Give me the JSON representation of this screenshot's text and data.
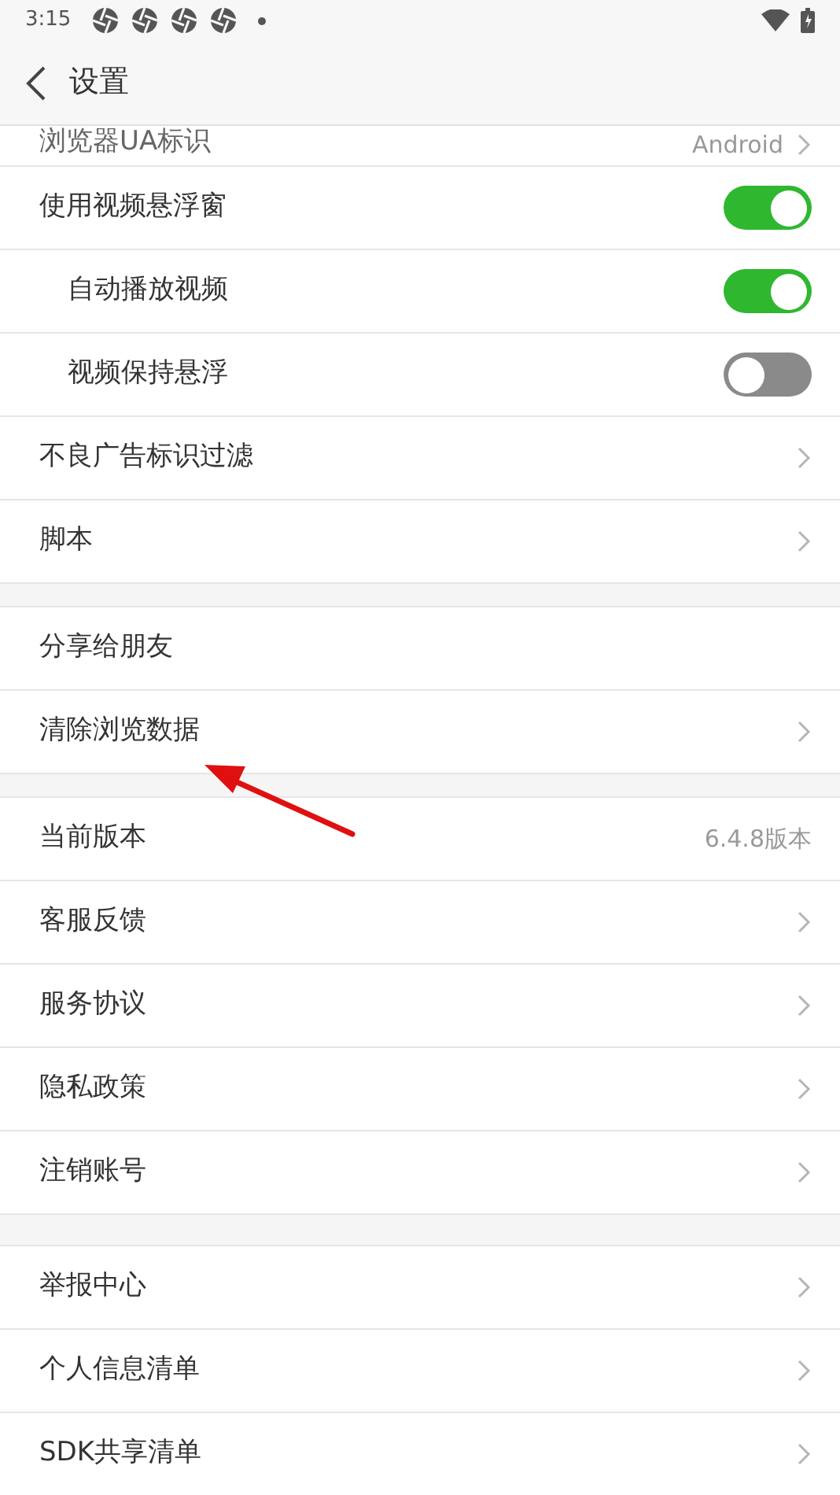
{
  "status_bar": {
    "time": "3:15"
  },
  "header": {
    "title": "设置"
  },
  "sections": [
    {
      "rows": [
        {
          "kind": "value_link",
          "label": "浏览器UA标识",
          "value": "Android",
          "partial": true
        },
        {
          "kind": "toggle",
          "label": "使用视频悬浮窗",
          "on": true,
          "children": [
            {
              "kind": "toggle",
              "label": "自动播放视频",
              "on": true
            },
            {
              "kind": "toggle",
              "label": "视频保持悬浮",
              "on": false
            }
          ]
        },
        {
          "kind": "link",
          "label": "不良广告标识过滤"
        },
        {
          "kind": "link",
          "label": "脚本"
        }
      ]
    },
    {
      "rows": [
        {
          "kind": "plain",
          "label": "分享给朋友"
        },
        {
          "kind": "link",
          "label": "清除浏览数据"
        }
      ]
    },
    {
      "rows": [
        {
          "kind": "value",
          "label": "当前版本",
          "value": "6.4.8版本"
        },
        {
          "kind": "link",
          "label": "客服反馈"
        },
        {
          "kind": "link",
          "label": "服务协议"
        },
        {
          "kind": "link",
          "label": "隐私政策"
        },
        {
          "kind": "link",
          "label": "注销账号"
        }
      ]
    },
    {
      "rows": [
        {
          "kind": "link",
          "label": "举报中心"
        },
        {
          "kind": "link",
          "label": "个人信息清单"
        },
        {
          "kind": "link",
          "label": "SDK共享清单"
        }
      ]
    }
  ]
}
